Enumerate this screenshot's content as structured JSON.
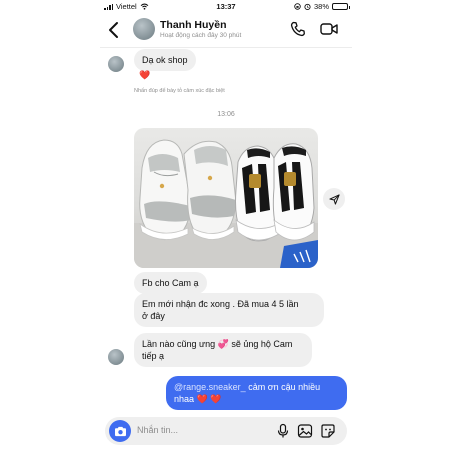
{
  "status_bar": {
    "carrier": "Viettel",
    "time": "13:37",
    "battery": "38%",
    "battery_level": 0.38
  },
  "header": {
    "name": "Thanh Huyền",
    "status": "Hoạt động cách đây 30 phút"
  },
  "messages": {
    "m1": "Dạ ok shop",
    "m1_hint": "Nhấn đúp để bày tỏ cảm xúc đặc biệt",
    "time_divider": "13:06",
    "m2": "Fb cho Cam ạ",
    "m3_line1": "Em mới nhận đc xong . Đã mua 4 5 lần",
    "m3_line2": "ở đây",
    "m4_line1": "Lần nào cũng ưng",
    "m4_line1b": "sẽ ủng hộ Cam",
    "m4_line2": "tiếp ạ",
    "out_mention": "@range.sneaker_",
    "out_line1": "cảm ơn cậu nhiều",
    "out_line2": "nhaa"
  },
  "composer": {
    "placeholder": "Nhắn tin..."
  },
  "colors": {
    "accent": "#3f6cf0",
    "incoming": "#efefef",
    "heart": "#e0262f"
  },
  "icons": [
    "back-icon",
    "phone-icon",
    "video-icon",
    "share-icon",
    "camera-icon",
    "microphone-icon",
    "gallery-icon",
    "sticker-icon"
  ]
}
